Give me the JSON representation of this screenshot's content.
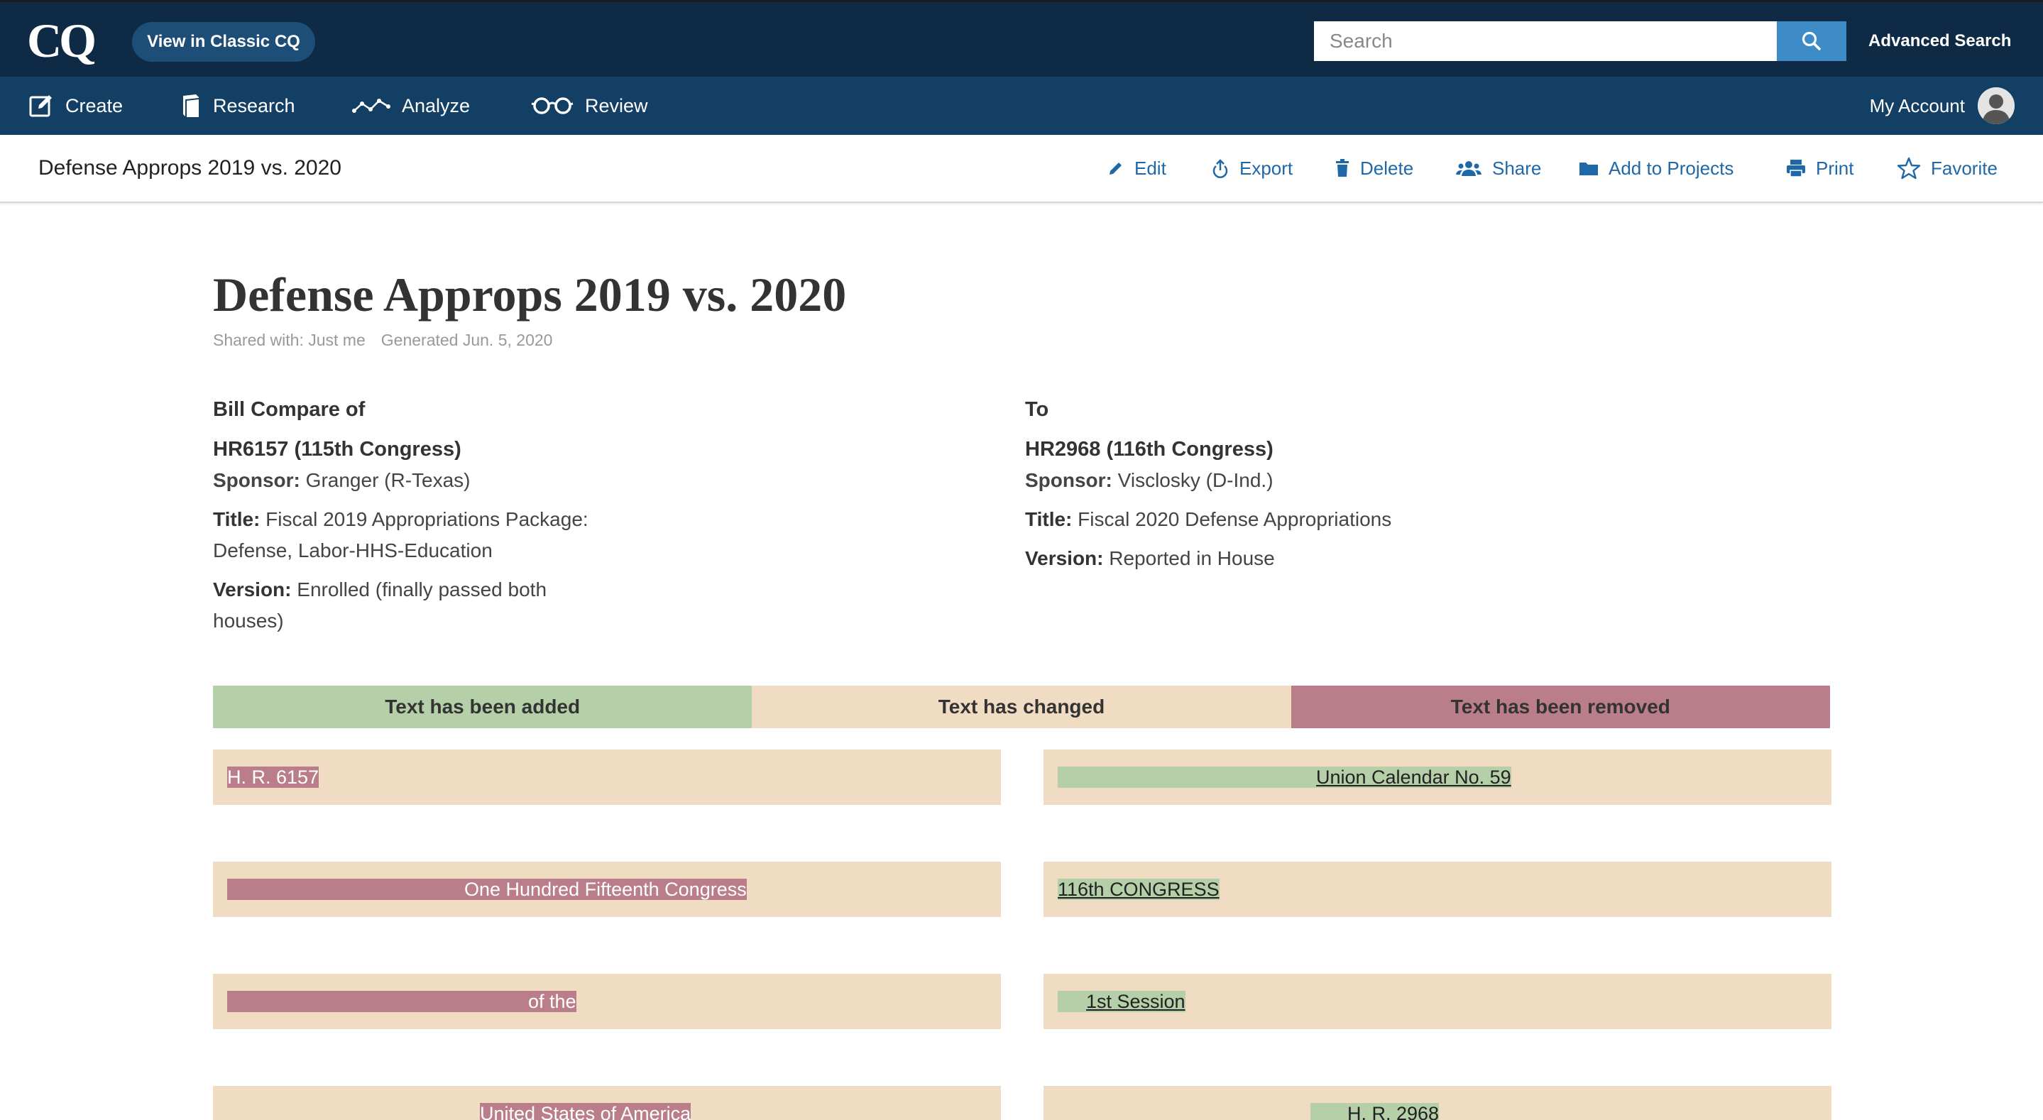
{
  "app": {
    "logo_text": "CQ",
    "classic_button": "View in Classic CQ",
    "search_placeholder": "Search",
    "advanced_search": "Advanced Search"
  },
  "nav": {
    "items": [
      {
        "label": "Create",
        "icon": "edit-icon"
      },
      {
        "label": "Research",
        "icon": "book-icon"
      },
      {
        "label": "Analyze",
        "icon": "analyze-icon"
      },
      {
        "label": "Review",
        "icon": "glasses-icon"
      }
    ],
    "account_label": "My Account"
  },
  "toolbar": {
    "title": "Defense Approps 2019 vs. 2020",
    "actions": [
      {
        "label": "Edit",
        "icon": "pencil-icon"
      },
      {
        "label": "Export",
        "icon": "export-icon"
      },
      {
        "label": "Delete",
        "icon": "trash-icon"
      },
      {
        "label": "Share",
        "icon": "share-icon"
      },
      {
        "label": "Add to Projects",
        "icon": "folder-icon"
      },
      {
        "label": "Print",
        "icon": "print-icon"
      },
      {
        "label": "Favorite",
        "icon": "star-icon"
      }
    ]
  },
  "document": {
    "title": "Defense Approps 2019 vs. 2020",
    "shared_with": "Shared with: Just me",
    "generated": "Generated Jun. 5, 2020"
  },
  "compare": {
    "left": {
      "heading": "Bill Compare of",
      "bill": "HR6157 (115th Congress)",
      "sponsor_label": "Sponsor:",
      "sponsor": "Granger (R-Texas)",
      "title_label": "Title:",
      "title": "Fiscal 2019 Appropriations Package: Defense, Labor-HHS-Education",
      "version_label": "Version:",
      "version": "Enrolled (finally passed both houses)"
    },
    "right": {
      "heading": "To",
      "bill": "HR2968 (116th Congress)",
      "sponsor_label": "Sponsor:",
      "sponsor": "Visclosky (D-Ind.)",
      "title_label": "Title:",
      "title": "Fiscal 2020 Defense Appropriations",
      "version_label": "Version:",
      "version": "Reported in House"
    }
  },
  "legend": {
    "added": "Text has been added",
    "changed": "Text has changed",
    "removed": "Text has been removed"
  },
  "colors": {
    "added": "#b5cfa8",
    "changed": "#efdcc3",
    "removed": "#b97e8a",
    "header_bg": "#0e2a45",
    "nav_bg": "#123f63",
    "link": "#1f68a8"
  },
  "diff_rows": [
    {
      "left": "H. R. 6157",
      "right": "Union Calendar No. 59"
    },
    {
      "left": "One Hundred Fifteenth Congress",
      "right": "116th CONGRESS"
    },
    {
      "left": "of the",
      "right": "1st Session"
    },
    {
      "left": "United States of America",
      "right": "H. R. 2968"
    }
  ]
}
